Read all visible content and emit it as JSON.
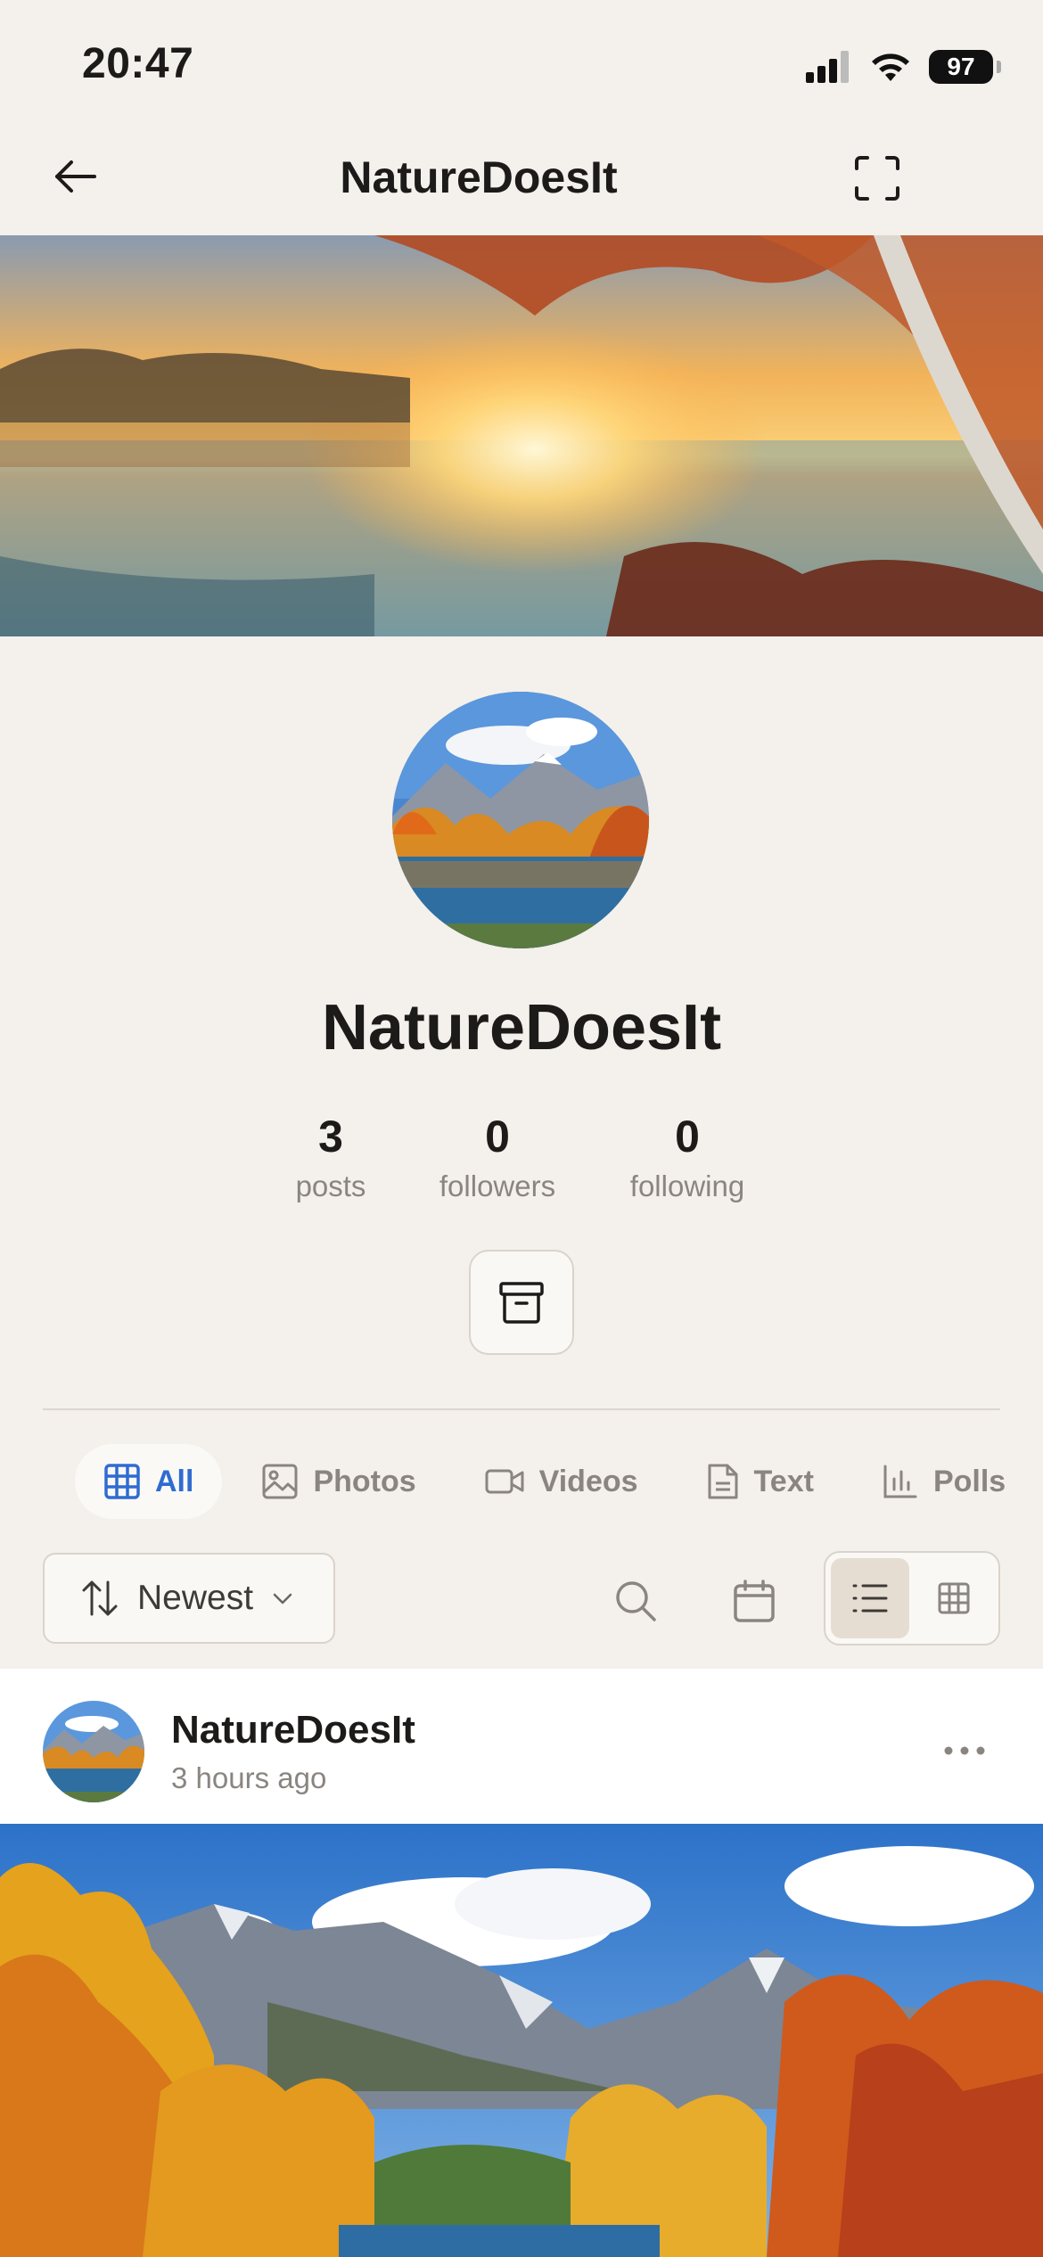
{
  "status_bar": {
    "time": "20:47",
    "battery": "97",
    "icons": [
      "signal-icon",
      "wifi-icon",
      "battery-icon"
    ]
  },
  "header": {
    "title": "NatureDoesIt",
    "back_icon": "arrow-left-icon",
    "action_icon": "scan-frame-icon"
  },
  "profile": {
    "name": "NatureDoesIt",
    "stats": [
      {
        "value": "3",
        "label": "posts"
      },
      {
        "value": "0",
        "label": "followers"
      },
      {
        "value": "0",
        "label": "following"
      }
    ],
    "archive_icon": "archive-box-icon"
  },
  "filters": {
    "tabs": [
      {
        "label": "All",
        "icon": "grid-icon",
        "active": true
      },
      {
        "label": "Photos",
        "icon": "image-icon",
        "active": false
      },
      {
        "label": "Videos",
        "icon": "video-icon",
        "active": false
      },
      {
        "label": "Text",
        "icon": "document-icon",
        "active": false
      },
      {
        "label": "Polls",
        "icon": "bar-chart-icon",
        "active": false
      }
    ]
  },
  "toolbar": {
    "sort_label": "Newest",
    "icons": [
      "sort-icon",
      "chevron-down-icon",
      "search-icon",
      "calendar-icon",
      "list-view-icon",
      "grid-view-icon"
    ],
    "active_view": "list"
  },
  "post": {
    "author": "NatureDoesIt",
    "time": "3 hours ago",
    "more_icon": "more-horizontal-icon"
  },
  "colors": {
    "background": "#f4f0eb",
    "accent": "#2f6cd1",
    "muted_text": "#8a8580"
  }
}
